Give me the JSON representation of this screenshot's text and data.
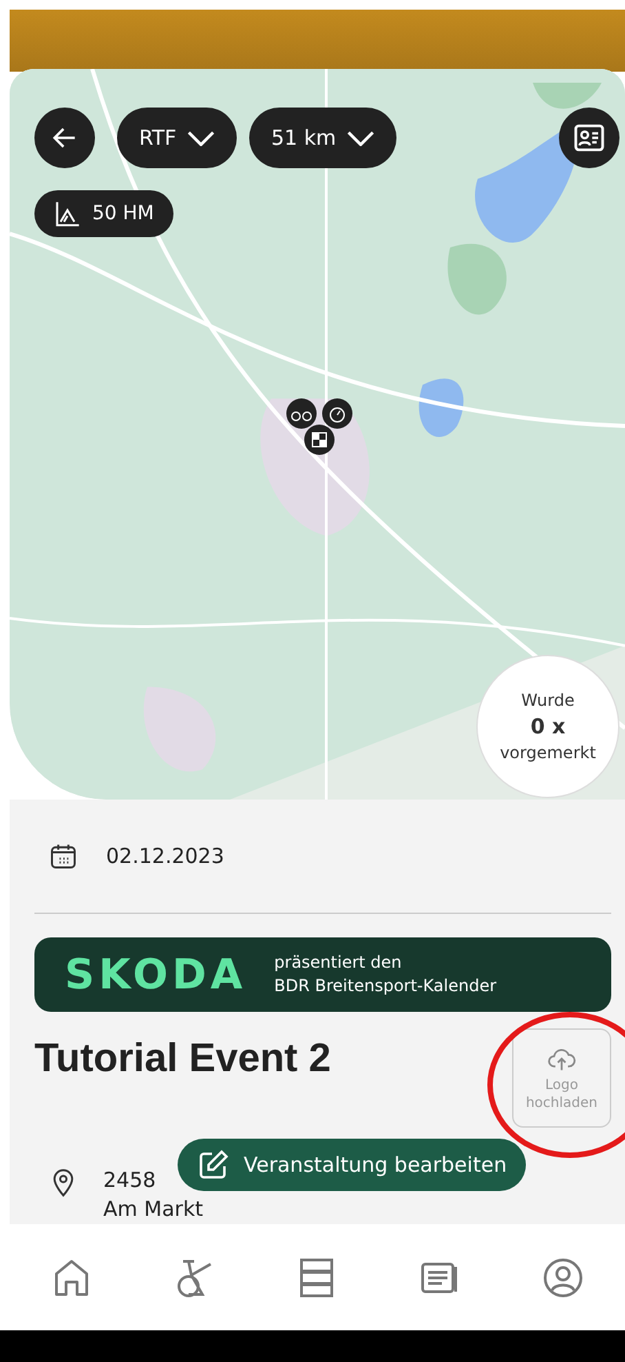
{
  "map": {
    "kind": "picture",
    "filters": [
      {
        "label": "RTF",
        "kind": "dropdown"
      },
      {
        "label": "51 km",
        "kind": "dropdown"
      },
      {
        "label": "50 HM",
        "kind": "elevation"
      }
    ],
    "bookmark_badge": {
      "line_1": "Wurde",
      "count": "0 x",
      "line_2": "vorgemerkt"
    }
  },
  "date": "02.12.2023",
  "sponsor_banner": {
    "logo": "SKODA",
    "line_1": "präsentiert den",
    "line_2": "BDR Breitensport-Kalender"
  },
  "title": "Tutorial Event 2",
  "logo_upload": {
    "label": "Logo hochladen",
    "annotated": true
  },
  "address": {
    "line_1": "2458",
    "line_2": "Am Markt"
  },
  "edit_button": "Veranstaltung bearbeiten",
  "nav": [
    {
      "kind": "home"
    },
    {
      "kind": "bike"
    },
    {
      "kind": "list"
    },
    {
      "kind": "news"
    },
    {
      "kind": "profile"
    }
  ]
}
